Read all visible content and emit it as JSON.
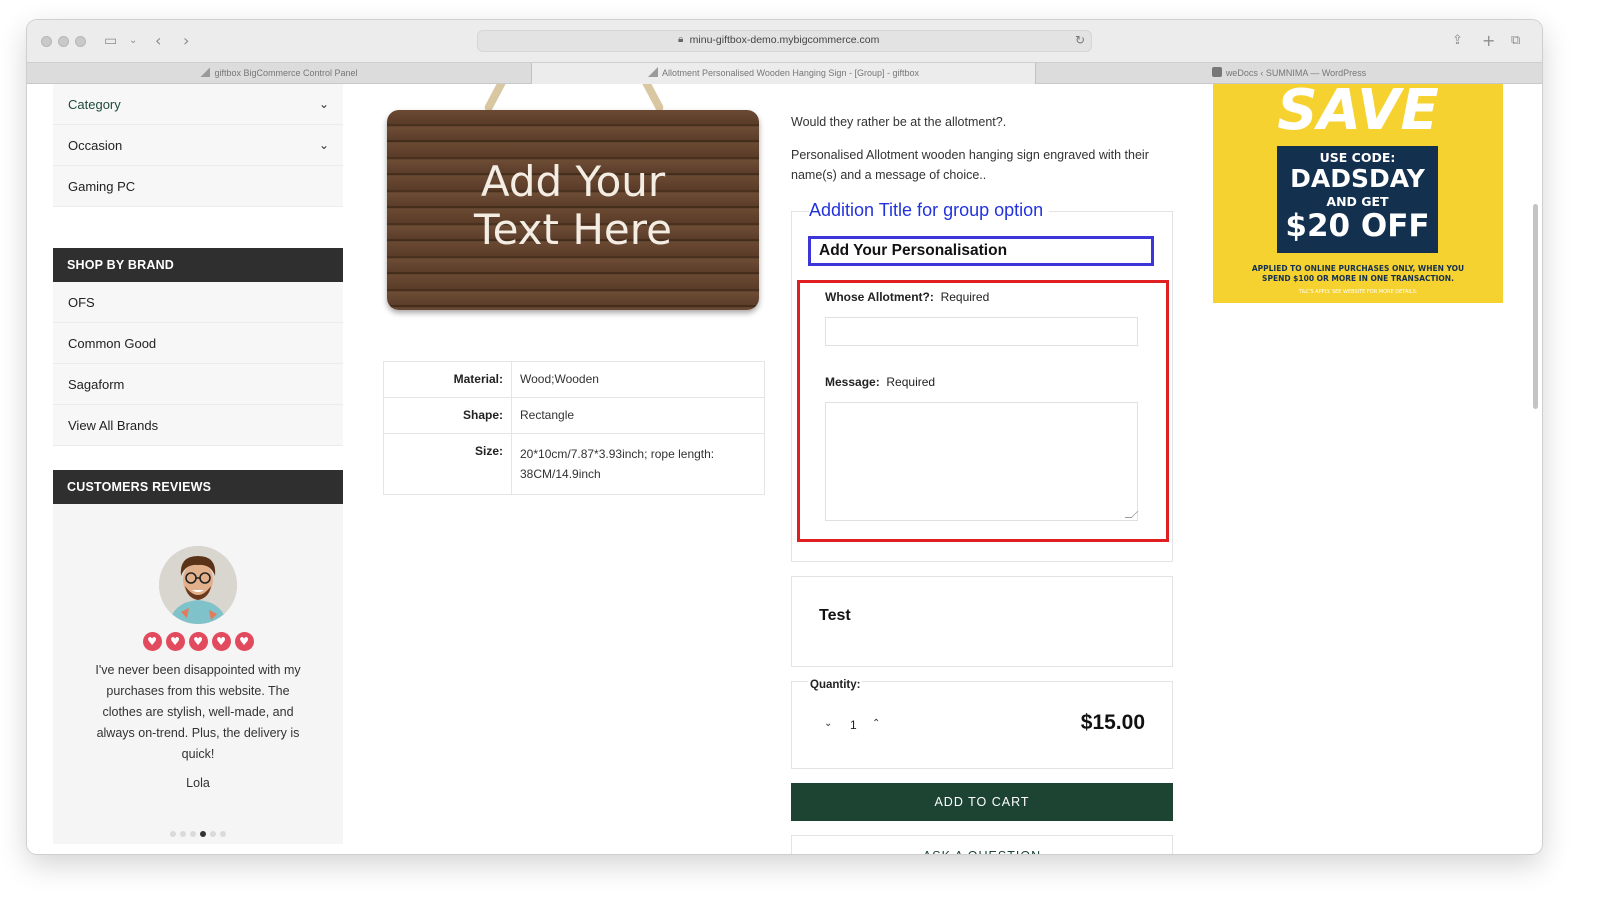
{
  "browser": {
    "url": "minu-giftbox-demo.mybigcommerce.com",
    "tabs": [
      {
        "label": "giftbox BigCommerce Control Panel"
      },
      {
        "label": "Allotment Personalised Wooden Hanging Sign - [Group] - giftbox"
      },
      {
        "label": "weDocs ‹ SUMNIMA — WordPress"
      }
    ]
  },
  "sidebar": {
    "top_items": [
      {
        "label": "Category"
      },
      {
        "label": "Occasion"
      },
      {
        "label": "Gaming PC"
      }
    ],
    "brand_heading": "SHOP BY BRAND",
    "brands": [
      {
        "label": "OFS"
      },
      {
        "label": "Common Good"
      },
      {
        "label": "Sagaform"
      },
      {
        "label": "View All Brands"
      }
    ],
    "reviews_heading": "CUSTOMERS REVIEWS",
    "review": {
      "rating": 5,
      "text": "I've never been disappointed with my purchases from this website. The clothes are stylish, well-made, and always on-trend. Plus, the delivery is quick!",
      "author": "Lola",
      "slide_count": 6,
      "active_slide": 4
    }
  },
  "product": {
    "image_text_line1": "Add Your",
    "image_text_line2": "Text Here",
    "specs": [
      {
        "key": "Material:",
        "value": "Wood;Wooden"
      },
      {
        "key": "Shape:",
        "value": "Rectangle"
      },
      {
        "key": "Size:",
        "value": "20*10cm/7.87*3.93inch; rope length: 38CM/14.9inch"
      }
    ],
    "desc_line1": "Would they rather be at the allotment?.",
    "desc_line2": "Personalised Allotment wooden hanging sign engraved with their name(s) and a message of choice..",
    "group_title": "Addition Title for group option",
    "personalisation_heading": "Add Your Personalisation",
    "field1_label": "Whose Allotment?:",
    "field1_required": "Required",
    "field1_value": "",
    "field2_label": "Message:",
    "field2_required": "Required",
    "field2_value": "",
    "test_heading": "Test",
    "quantity_label": "Quantity:",
    "quantity": "1",
    "price": "$15.00",
    "add_to_cart": "ADD TO CART",
    "ask_question": "ASK A QUESTION"
  },
  "promo": {
    "headline": "SAVE",
    "code_label": "USE CODE:",
    "code": "DADSDAY",
    "and_get": "AND GET",
    "offer": "$20 OFF",
    "fine_print": "APPLIED TO ONLINE PURCHASES ONLY, WHEN YOU SPEND $100 OR MORE IN ONE TRANSACTION.",
    "terms": "T&C'S APPLY. SEE WEBSITE FOR MORE DETAILS."
  },
  "colors": {
    "accent_green": "#1d4433",
    "heart_red": "#e24a5e",
    "promo_yellow": "#f5d22f",
    "promo_navy": "#14304f",
    "highlight_blue": "#3c35d8",
    "highlight_red": "#e02020"
  }
}
